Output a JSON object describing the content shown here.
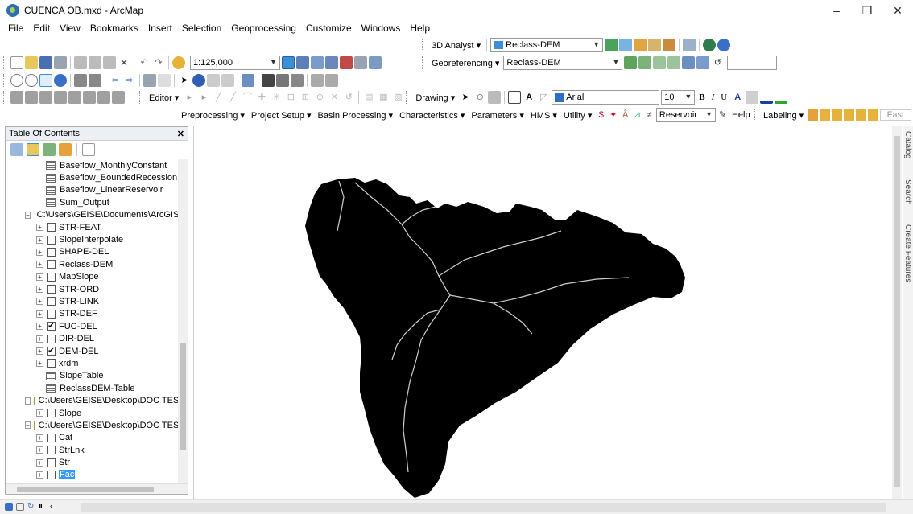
{
  "window": {
    "title": "CUENCA OB.mxd - ArcMap",
    "controls": [
      "–",
      "❐",
      "✕"
    ]
  },
  "menu": [
    "File",
    "Edit",
    "View",
    "Bookmarks",
    "Insert",
    "Selection",
    "Geoprocessing",
    "Customize",
    "Windows",
    "Help"
  ],
  "toolbars": {
    "analyst3d_label": "3D Analyst ▾",
    "analyst3d_layer": "Reclass-DEM",
    "scale": "1:125,000",
    "georef_label": "Georeferencing ▾",
    "georef_layer": "Reclass-DEM",
    "editor_label": "Editor ▾",
    "drawing_label": "Drawing ▾",
    "font_name": "Arial",
    "font_size": "10",
    "bold": "B",
    "italic": "I",
    "underline": "U",
    "hms_menus": [
      "Preprocessing ▾",
      "Project Setup ▾",
      "Basin Processing ▾",
      "Characteristics ▾",
      "Parameters ▾",
      "HMS ▾",
      "Utility ▾"
    ],
    "reservoir_layer": "Reservoir",
    "help_label": "Help",
    "labeling_label": "Labeling ▾",
    "fast_label": "Fast"
  },
  "toc": {
    "title": "Table Of Contents",
    "close": "✕",
    "items": [
      {
        "type": "table",
        "label": "Baseflow_MonthlyConstant",
        "indent": 3
      },
      {
        "type": "table",
        "label": "Baseflow_BoundedRecession",
        "indent": 3
      },
      {
        "type": "table",
        "label": "Baseflow_LinearReservoir",
        "indent": 3
      },
      {
        "type": "table",
        "label": "Sum_Output",
        "indent": 3
      },
      {
        "type": "gdb",
        "label": "C:\\Users\\GEISE\\Documents\\ArcGIS\\",
        "indent": 1,
        "expander": "−"
      },
      {
        "type": "layer",
        "label": "STR-FEAT",
        "indent": 2,
        "checked": false
      },
      {
        "type": "layer",
        "label": "SlopeInterpolate",
        "indent": 2,
        "checked": false
      },
      {
        "type": "layer",
        "label": "SHAPE-DEL",
        "indent": 2,
        "checked": false
      },
      {
        "type": "layer",
        "label": "Reclass-DEM",
        "indent": 2,
        "checked": false
      },
      {
        "type": "layer",
        "label": "MapSlope",
        "indent": 2,
        "checked": false
      },
      {
        "type": "layer",
        "label": "STR-ORD",
        "indent": 2,
        "checked": false
      },
      {
        "type": "layer",
        "label": "STR-LINK",
        "indent": 2,
        "checked": false
      },
      {
        "type": "layer",
        "label": "STR-DEF",
        "indent": 2,
        "checked": false
      },
      {
        "type": "layer",
        "label": "FUC-DEL",
        "indent": 2,
        "checked": true
      },
      {
        "type": "layer",
        "label": "DIR-DEL",
        "indent": 2,
        "checked": false
      },
      {
        "type": "layer",
        "label": "DEM-DEL",
        "indent": 2,
        "checked": true
      },
      {
        "type": "layer",
        "label": "xrdm",
        "indent": 2,
        "checked": false
      },
      {
        "type": "table",
        "label": "SlopeTable",
        "indent": 3
      },
      {
        "type": "table",
        "label": "ReclassDEM-Table",
        "indent": 3
      },
      {
        "type": "folder",
        "label": "C:\\Users\\GEISE\\Desktop\\DOC TESIS\\",
        "indent": 1,
        "expander": "−"
      },
      {
        "type": "layer",
        "label": "Slope",
        "indent": 2,
        "checked": false
      },
      {
        "type": "folder",
        "label": "C:\\Users\\GEISE\\Desktop\\DOC TESIS\\",
        "indent": 1,
        "expander": "−"
      },
      {
        "type": "layer",
        "label": "Cat",
        "indent": 2,
        "checked": false
      },
      {
        "type": "layer",
        "label": "StrLnk",
        "indent": 2,
        "checked": false
      },
      {
        "type": "layer",
        "label": "Str",
        "indent": 2,
        "checked": false
      },
      {
        "type": "layer",
        "label": "Fac",
        "indent": 2,
        "checked": false,
        "selected": true
      },
      {
        "type": "layer",
        "label": "Fdr",
        "indent": 2,
        "checked": false
      }
    ]
  },
  "sidetabs": [
    "Catalog",
    "Search",
    "Create Features"
  ],
  "colors": {
    "basin_fill": "#000000",
    "stream": "#cfcfcf",
    "selection": "#3399ff"
  }
}
